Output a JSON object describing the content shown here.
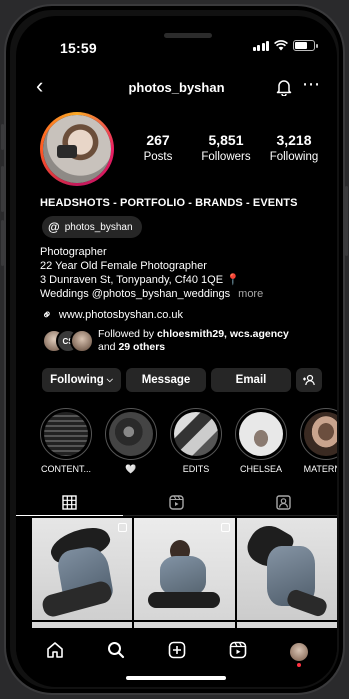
{
  "status_bar": {
    "time": "15:59"
  },
  "header": {
    "username": "photos_byshan",
    "more_label": "⋯",
    "back_label": "‹"
  },
  "profile": {
    "posts": {
      "count": "267",
      "label": "Posts"
    },
    "followers": {
      "count": "5,851",
      "label": "Followers"
    },
    "following": {
      "count": "3,218",
      "label": "Following"
    },
    "category": "HEADSHOTS - PORTFOLIO - BRANDS - EVENTS",
    "threads_handle": "photos_byshan",
    "bio": {
      "line1": "Photographer",
      "line2": "22 Year Old Female Photographer",
      "line3": "3 Dunraven St, Tonypandy, Cf40 1QE 📍",
      "line4": "Weddings @photos_byshan_weddings",
      "more": "more"
    },
    "link": "www.photosbyshan.co.uk",
    "followed_by": {
      "prefix": "Followed by",
      "names": "chloesmith29, wcs.agency",
      "and": "and",
      "others": "29 others",
      "mini_avatar_initials": "CS"
    }
  },
  "actions": {
    "following": "Following",
    "message": "Message",
    "email": "Email",
    "add_icon": "+👤"
  },
  "highlights": [
    {
      "label": "CONTENT..."
    },
    {
      "label": "🤍"
    },
    {
      "label": "EDITS"
    },
    {
      "label": "CHELSEA"
    },
    {
      "label": "MATERN..."
    }
  ],
  "tabs": [
    "grid-icon",
    "reels-icon",
    "tagged-icon"
  ],
  "colors": {
    "accent_ring": "#e91e63",
    "background": "#000000",
    "button_bg": "#262626",
    "notification_dot": "#ff3040"
  }
}
